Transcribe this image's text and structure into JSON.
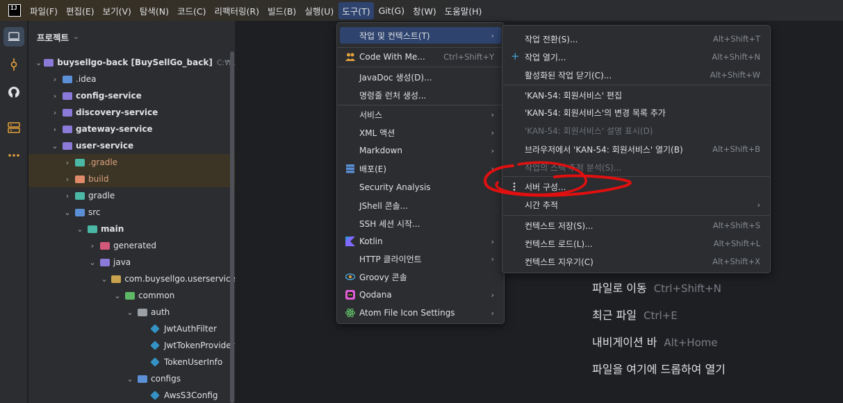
{
  "menubar": {
    "logo": "IJ",
    "items": [
      "파일(F)",
      "편집(E)",
      "보기(V)",
      "탐색(N)",
      "코드(C)",
      "리팩터링(R)",
      "빌드(B)",
      "실행(U)",
      "도구(T)",
      "Git(G)",
      "창(W)",
      "도움말(H)"
    ]
  },
  "panel": {
    "title": "프로젝트",
    "tree": [
      {
        "label": "buysellgo-back [BuySellGo_back]",
        "hint": "C:₩Users₩"
      },
      {
        "label": ".idea"
      },
      {
        "label": "config-service"
      },
      {
        "label": "discovery-service"
      },
      {
        "label": "gateway-service"
      },
      {
        "label": "user-service"
      },
      {
        "label": ".gradle"
      },
      {
        "label": "build"
      },
      {
        "label": "gradle"
      },
      {
        "label": "src"
      },
      {
        "label": "main"
      },
      {
        "label": "generated"
      },
      {
        "label": "java"
      },
      {
        "label": "com.buysellgo.userservice"
      },
      {
        "label": "common"
      },
      {
        "label": "auth"
      },
      {
        "label": "JwtAuthFilter"
      },
      {
        "label": "JwtTokenProvider"
      },
      {
        "label": "TokenUserInfo"
      },
      {
        "label": "configs"
      },
      {
        "label": "AwsS3Config"
      }
    ]
  },
  "tools_menu": {
    "items": [
      {
        "label": "작업 및 컨텍스트(T)",
        "submenu": "›"
      },
      {
        "label": "Code With Me...",
        "shortcut": "Ctrl+Shift+Y"
      },
      {
        "label": "JavaDoc 생성(D)..."
      },
      {
        "label": "명령줄 런처 생성..."
      },
      {
        "label": "서비스",
        "submenu": "›"
      },
      {
        "label": "XML 액션",
        "submenu": "›"
      },
      {
        "label": "Markdown",
        "submenu": "›"
      },
      {
        "label": "배포(E)",
        "submenu": "›"
      },
      {
        "label": "Security Analysis"
      },
      {
        "label": "JShell 콘솔..."
      },
      {
        "label": "SSH 세션 시작..."
      },
      {
        "label": "Kotlin",
        "submenu": "›"
      },
      {
        "label": "HTTP 클라이언트",
        "submenu": "›"
      },
      {
        "label": "Groovy 콘솔"
      },
      {
        "label": "Qodana",
        "submenu": "›"
      },
      {
        "label": "Atom File Icon Settings",
        "submenu": "›"
      }
    ]
  },
  "ctx_menu": {
    "items": [
      {
        "label": "작업 전환(S)...",
        "shortcut": "Alt+Shift+T"
      },
      {
        "label": "작업 열기...",
        "shortcut": "Alt+Shift+N"
      },
      {
        "label": "활성화된 작업 닫기(C)...",
        "shortcut": "Alt+Shift+W"
      },
      {
        "label": "'KAN-54: 회원서비스' 편집"
      },
      {
        "label": "'KAN-54: 회원서비스'의 변경 목록 추가"
      },
      {
        "label": "'KAN-54: 회원서비스' 설명 표시(D)"
      },
      {
        "label": "브라우저에서 'KAN-54: 회원서비스' 열기(B)",
        "shortcut": "Alt+Shift+B"
      },
      {
        "label": "작업의 스택 추적 분석(S)..."
      },
      {
        "label": "서버 구성..."
      },
      {
        "label": "시간 추적",
        "submenu": "›"
      },
      {
        "label": "컨텍스트 저장(S)...",
        "shortcut": "Alt+Shift+S"
      },
      {
        "label": "컨텍스트 로드(L)...",
        "shortcut": "Alt+Shift+L"
      },
      {
        "label": "컨텍스트 지우기(C)",
        "shortcut": "Alt+Shift+X"
      }
    ]
  },
  "editor_hints": [
    {
      "label": "파일로 이동",
      "key": "Ctrl+Shift+N"
    },
    {
      "label": "최근 파일",
      "key": "Ctrl+E"
    },
    {
      "label": "내비게이션 바",
      "key": "Alt+Home"
    },
    {
      "label": "파일을 여기에 드롭하여 열기",
      "key": ""
    }
  ],
  "colors": {
    "accent": "#2e436e",
    "annotation": "#e01010"
  }
}
